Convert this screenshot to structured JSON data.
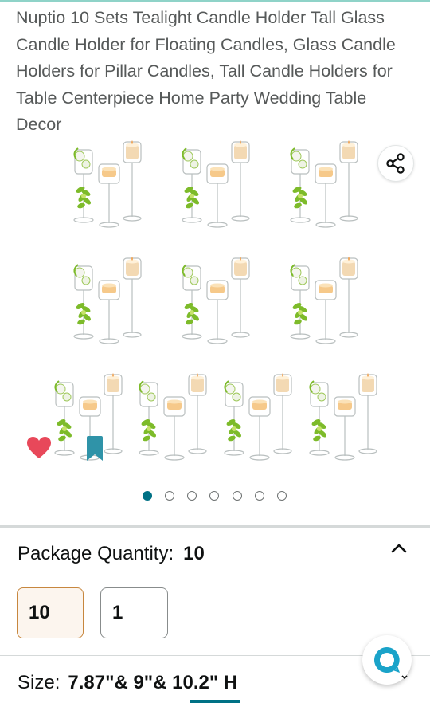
{
  "product": {
    "title": "Nuptio 10 Sets Tealight Candle Holder Tall Glass Candle Holder for Floating Candles, Glass Candle Holders for Pillar Candles, Tall Candle Holders for Table Centerpiece Home Party Wedding Table Decor"
  },
  "gallery": {
    "icons": {
      "share": "share-icon",
      "favorite": "heart-icon",
      "save": "bookmark-icon"
    },
    "colors": {
      "heart": "#e8485a",
      "bookmark": "#2f93a8",
      "candle_flame": "#f6c98a",
      "leaf": "#7dbb2a"
    },
    "carousel": {
      "total": 7,
      "active": 1
    }
  },
  "package": {
    "label": "Package Quantity:",
    "value": "10",
    "options": [
      {
        "label": "10",
        "selected": true
      },
      {
        "label": "1",
        "selected": false
      }
    ]
  },
  "size": {
    "label": "Size:",
    "value": "7.87\"& 9\"& 10.2\" H"
  },
  "colors": {
    "accent": "#007185",
    "selected_border": "#c7873e",
    "selected_bg": "#fcf5ee"
  }
}
